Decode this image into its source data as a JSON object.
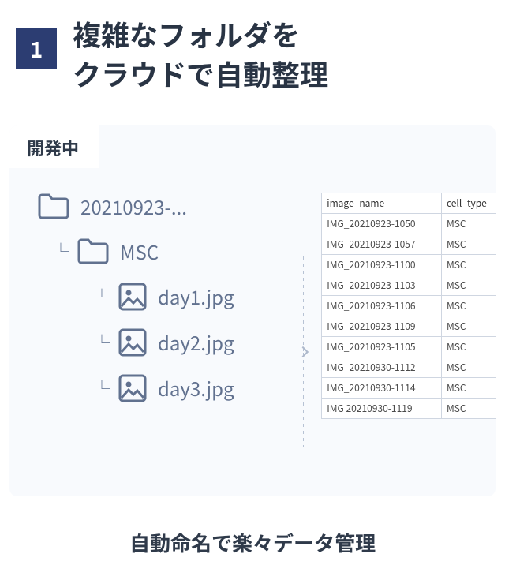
{
  "header": {
    "number": "1",
    "title_line1": "複雑なフォルダを",
    "title_line2": "クラウドで自動整理"
  },
  "card": {
    "badge": "開発中",
    "tree": {
      "root_folder": "20210923-...",
      "sub_folder": "MSC",
      "files": [
        "day1.jpg",
        "day2.jpg",
        "day3.jpg"
      ]
    },
    "table": {
      "headers": [
        "image_name",
        "cell_type"
      ],
      "rows": [
        [
          "IMG_20210923-1050",
          "MSC"
        ],
        [
          "IMG_20210923-1057",
          "MSC"
        ],
        [
          "IMG_20210923-1100",
          "MSC"
        ],
        [
          "IMG_20210923-1103",
          "MSC"
        ],
        [
          "IMG_20210923-1106",
          "MSC"
        ],
        [
          "IMG_20210923-1109",
          "MSC"
        ],
        [
          "IMG_20210923-1105",
          "MSC"
        ],
        [
          "IMG_20210930-1112",
          "MSC"
        ],
        [
          "IMG_20210930-1114",
          "MSC"
        ],
        [
          "IMG 20210930-1119",
          "MSC"
        ]
      ]
    }
  },
  "footer": "自動命名で楽々データ管理"
}
